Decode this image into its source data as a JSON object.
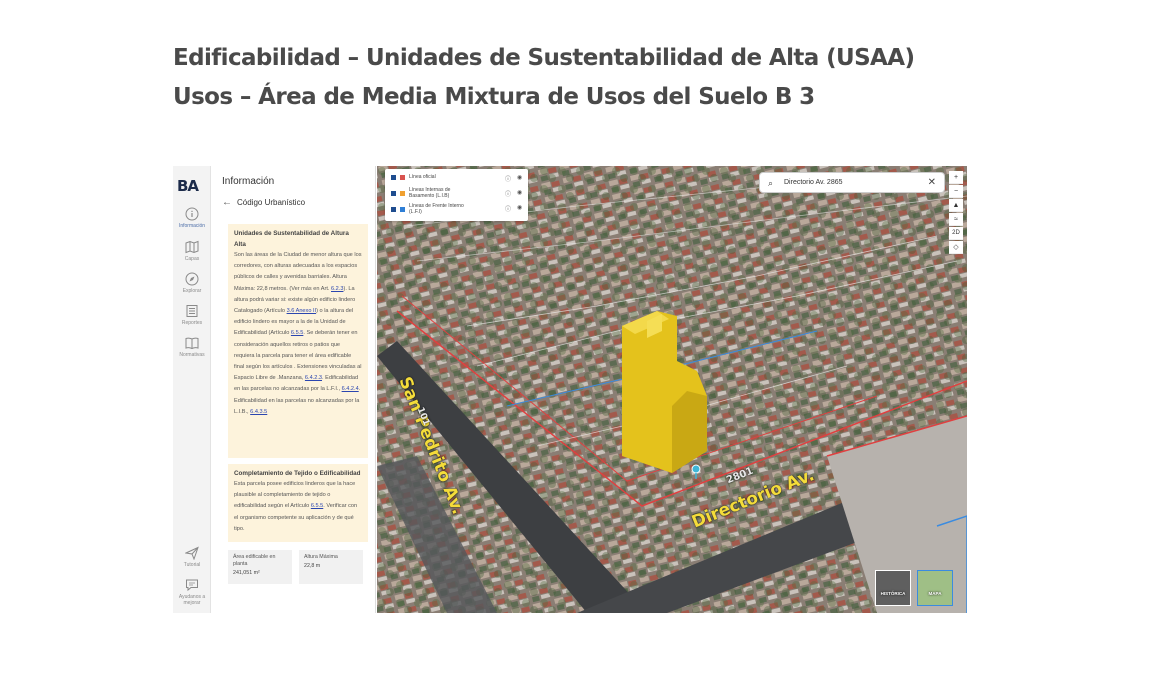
{
  "headings": {
    "line1": "Edificabilidad – Unidades de Sustentabilidad de Alta (USAA)",
    "line2": "Usos – Área de Media Mixtura de Usos del Suelo B 3"
  },
  "rail": {
    "logo": "BA",
    "items": [
      {
        "label": "Información",
        "icon": "info-icon"
      },
      {
        "label": "Capas",
        "icon": "map-icon"
      },
      {
        "label": "Explorar",
        "icon": "compass-icon"
      },
      {
        "label": "Reportes",
        "icon": "report-icon"
      },
      {
        "label": "Normativas",
        "icon": "book-icon"
      },
      {
        "label": "Tutorial",
        "icon": "send-icon"
      },
      {
        "label": "Ayudanos a mejorar",
        "icon": "feedback-icon"
      }
    ]
  },
  "panel": {
    "title": "Información",
    "back_label": "Código Urbanístico",
    "card1": {
      "title": "Unidades de Sustentabilidad de Altura Alta",
      "text_a": "Son las áreas de la Ciudad de menor altura que los corredores, con alturas adecuadas a los espacios públicos de calles y avenidas barriales. Altura Máxima: 22,8 metros. (Ver más en Art. ",
      "link1": "6.2.3",
      "text_b": "). La altura podrá variar si: existe algún edificio lindero Catalogado (Artículo ",
      "link2": "3.6 Anexo II",
      "text_c": ") o la altura del edificio lindero es mayor a la de la Unidad de Edificabilidad (Artículo ",
      "link3": "6.5.5",
      "text_d": ". Se deberán tener en consideración aquellos retiros o patios que requiera la parcela para tener el área edificable final según los artículos . Extensiones vinculadas al Espacio Libre de .Manzana, ",
      "link4": "6.4.2.3",
      "text_e": ". Edificabilidad en las parcelas no alcanzadas por la L.F.I., ",
      "link5": "6.4.2.4",
      "text_f": ". Edificabilidad en las parcelas no alcanzadas por la L.I.B., ",
      "link6": "6.4.3.5"
    },
    "card2": {
      "title": "Completamiento de Tejido o Edificabilidad",
      "text_a": "Esta parcela posee edificios linderos que la hace plausible al completamiento de tejido o edificabilidad según el Artículo ",
      "link1": "6.5.5",
      "text_b": ". Verificar con el organismo competente su aplicación y de qué tipo."
    },
    "stats": [
      {
        "label": "Área edificable en planta",
        "value": "241,051 m²"
      },
      {
        "label": "Altura Máxima",
        "value": "22,8 m"
      }
    ]
  },
  "map": {
    "layers": [
      {
        "label": "Línea oficial",
        "color": "#d9534f"
      },
      {
        "label": "Líneas Internas de Basamento (L.I.B)",
        "color": "#f0a030"
      },
      {
        "label": "Líneas de Frente Interno (L.F.I)",
        "color": "#2f7fd6"
      }
    ],
    "search_value": "Directorio Av. 2865",
    "controls": [
      "+",
      "−",
      "▲",
      "≈",
      "2D",
      "◇"
    ],
    "street1": "San Pedrito Av.",
    "street1_number": "101",
    "street2": "Directorio Av.",
    "street2_number": "2801",
    "thumbs": [
      "HISTÓRICA",
      "MAPA"
    ]
  }
}
